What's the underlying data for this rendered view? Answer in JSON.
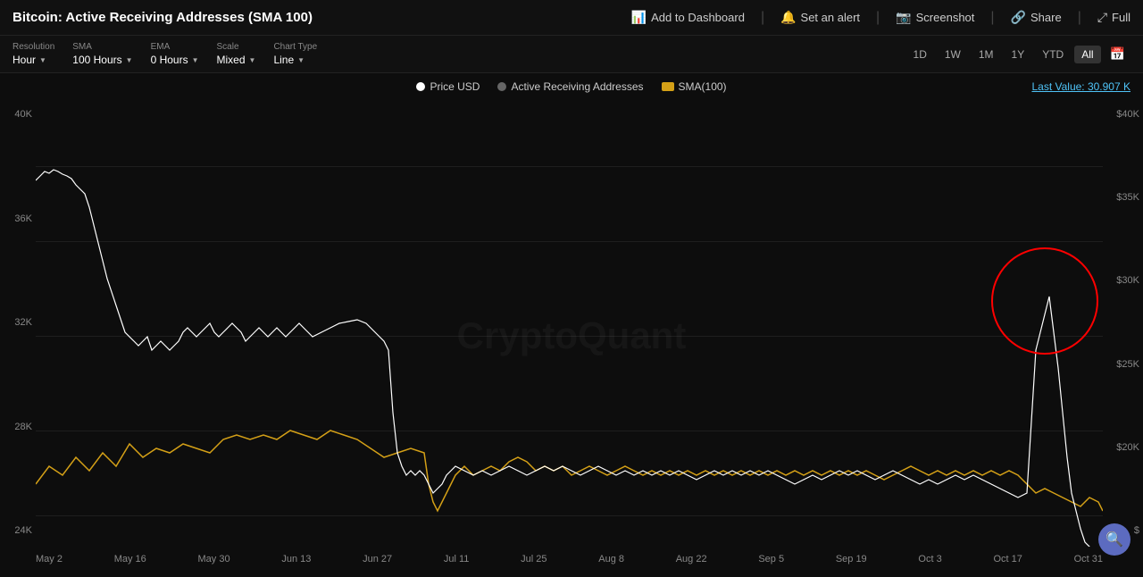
{
  "header": {
    "title": "Bitcoin: Active Receiving Addresses (SMA 100)",
    "actions": [
      {
        "id": "add-dashboard",
        "label": "Add to Dashboard",
        "icon": "📊"
      },
      {
        "id": "set-alert",
        "label": "Set an alert",
        "icon": "🔔"
      },
      {
        "id": "screenshot",
        "label": "Screenshot",
        "icon": "📷"
      },
      {
        "id": "share",
        "label": "Share",
        "icon": "🔗"
      },
      {
        "id": "full",
        "label": "Full",
        "icon": "⤢"
      }
    ]
  },
  "toolbar": {
    "resolution": {
      "label": "Resolution",
      "value": "Hour"
    },
    "sma": {
      "label": "SMA",
      "value": "100 Hours"
    },
    "ema": {
      "label": "EMA",
      "value": "0 Hours"
    },
    "scale": {
      "label": "Scale",
      "value": "Mixed"
    },
    "chartType": {
      "label": "Chart Type",
      "value": "Line"
    }
  },
  "timeRange": {
    "buttons": [
      "1D",
      "1W",
      "1M",
      "1Y",
      "YTD",
      "All"
    ],
    "active": "All"
  },
  "legend": {
    "items": [
      {
        "id": "price-usd",
        "label": "Price USD",
        "color": "white"
      },
      {
        "id": "active-receiving",
        "label": "Active Receiving Addresses",
        "color": "gray"
      },
      {
        "id": "sma100",
        "label": "SMA(100)",
        "color": "gold"
      }
    ],
    "lastValue": "Last Value: 30.907 K"
  },
  "yAxisLeft": [
    "40K",
    "36K",
    "32K",
    "28K",
    "24K"
  ],
  "yAxisRight": [
    "$40K",
    "$35K",
    "$30K",
    "$25K",
    "$20K",
    "$"
  ],
  "xAxisLabels": [
    "May 2",
    "May 16",
    "May 30",
    "Jun 13",
    "Jun 27",
    "Jul 11",
    "Jul 25",
    "Aug 8",
    "Aug 22",
    "Sep 5",
    "Sep 19",
    "Oct 3",
    "Oct 17",
    "Oct 31"
  ],
  "watermark": "CryptoQuant",
  "chart": {
    "circleAnnotation": true
  }
}
